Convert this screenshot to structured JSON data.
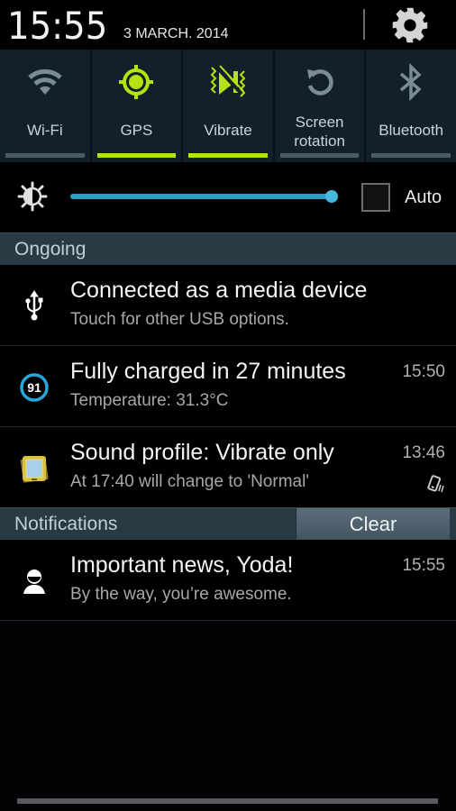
{
  "header": {
    "time": "15:55",
    "date": "3 MARCH. 2014",
    "settings_icon": "gear-icon"
  },
  "toggles": [
    {
      "label": "Wi-Fi",
      "icon": "wifi-icon",
      "state": "off"
    },
    {
      "label": "GPS",
      "icon": "gps-icon",
      "state": "on"
    },
    {
      "label": "Vibrate",
      "icon": "vibrate-icon",
      "state": "on"
    },
    {
      "label_line1": "Screen",
      "label_line2": "rotation",
      "icon": "rotation-icon",
      "state": "off"
    },
    {
      "label": "Bluetooth",
      "icon": "bluetooth-icon",
      "state": "off"
    }
  ],
  "brightness": {
    "icon": "brightness-icon",
    "level_percent": 100,
    "auto_label": "Auto",
    "auto_checked": false
  },
  "sections": {
    "ongoing": "Ongoing",
    "notifications": "Notifications",
    "clear_label": "Clear"
  },
  "ongoing": [
    {
      "icon": "usb-icon",
      "title": "Connected as a media device",
      "text": "Touch for other USB options.",
      "time": ""
    },
    {
      "icon": "battery-icon",
      "badge": "91",
      "title": "Fully charged in 27 minutes",
      "text": "Temperature: 31.3°C",
      "time": "15:50"
    },
    {
      "icon": "sound-profile-icon",
      "title": "Sound profile: Vibrate only",
      "text": "At 17:40 will change to 'Normal'",
      "time": "13:46",
      "small_icon": "vibrate-phone-icon"
    }
  ],
  "notifications": [
    {
      "icon": "person-icon",
      "title": "Important news, Yoda!",
      "text": "By the way, you’re awesome.",
      "time": "15:55"
    }
  ],
  "colors": {
    "accent_on": "#b6e212",
    "toggle_off": "#4a5a66",
    "slider": "#2a9ec4",
    "section_bg": "#283a44"
  }
}
